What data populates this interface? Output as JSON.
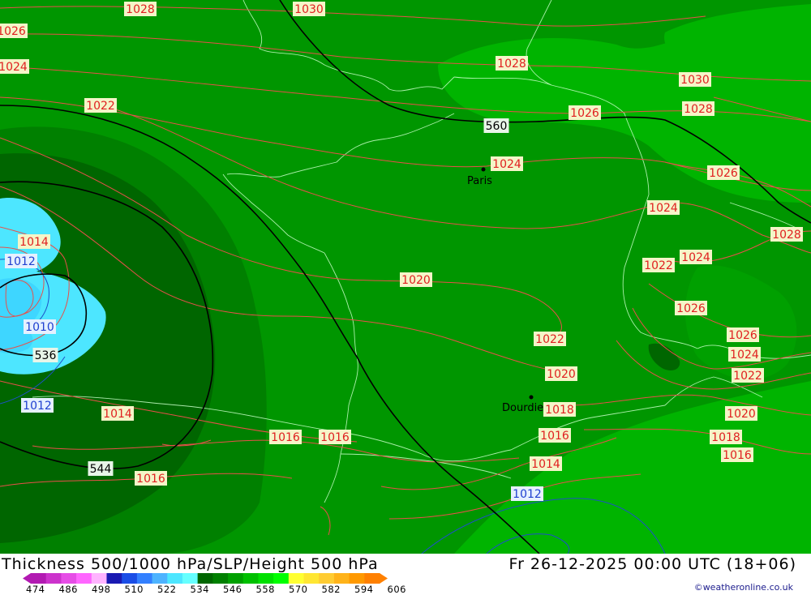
{
  "title": "Thickness 500/1000 hPa/SLP/Height 500 hPa",
  "valid_time": "Fr 26-12-2025 00:00 UTC (18+06)",
  "credit": "©weatheronline.co.uk",
  "cities": [
    {
      "name": "Paris"
    },
    {
      "name": "Dourdies"
    }
  ],
  "slp_labels": [
    "1028",
    "1030",
    "1026",
    "1024",
    "1028",
    "1030",
    "1028",
    "1026",
    "1022",
    "1024",
    "1026",
    "1024",
    "1028",
    "1022",
    "1024",
    "1026",
    "1014",
    "1012",
    "1010",
    "1020",
    "1022",
    "1026",
    "1024",
    "1022",
    "1020",
    "1012",
    "1014",
    "1016",
    "1016",
    "1020",
    "1018",
    "1016",
    "1018",
    "1016",
    "1014",
    "1016",
    "1012"
  ],
  "height_labels": [
    "560",
    "536",
    "544"
  ],
  "legend": {
    "ticks": [
      "474",
      "486",
      "498",
      "510",
      "522",
      "534",
      "546",
      "558",
      "570",
      "582",
      "594",
      "606"
    ],
    "colors": [
      "#b21ab2",
      "#cc33cc",
      "#e64de6",
      "#ff66ff",
      "#ffb3ff",
      "#1a1ab2",
      "#1a4de6",
      "#3380ff",
      "#4db3ff",
      "#4de6ff",
      "#66ffff",
      "#006600",
      "#008000",
      "#00a000",
      "#00c000",
      "#00e000",
      "#00ff00",
      "#ffff33",
      "#ffe633",
      "#ffcc33",
      "#ffb31a",
      "#ff9900",
      "#ff8000"
    ]
  }
}
